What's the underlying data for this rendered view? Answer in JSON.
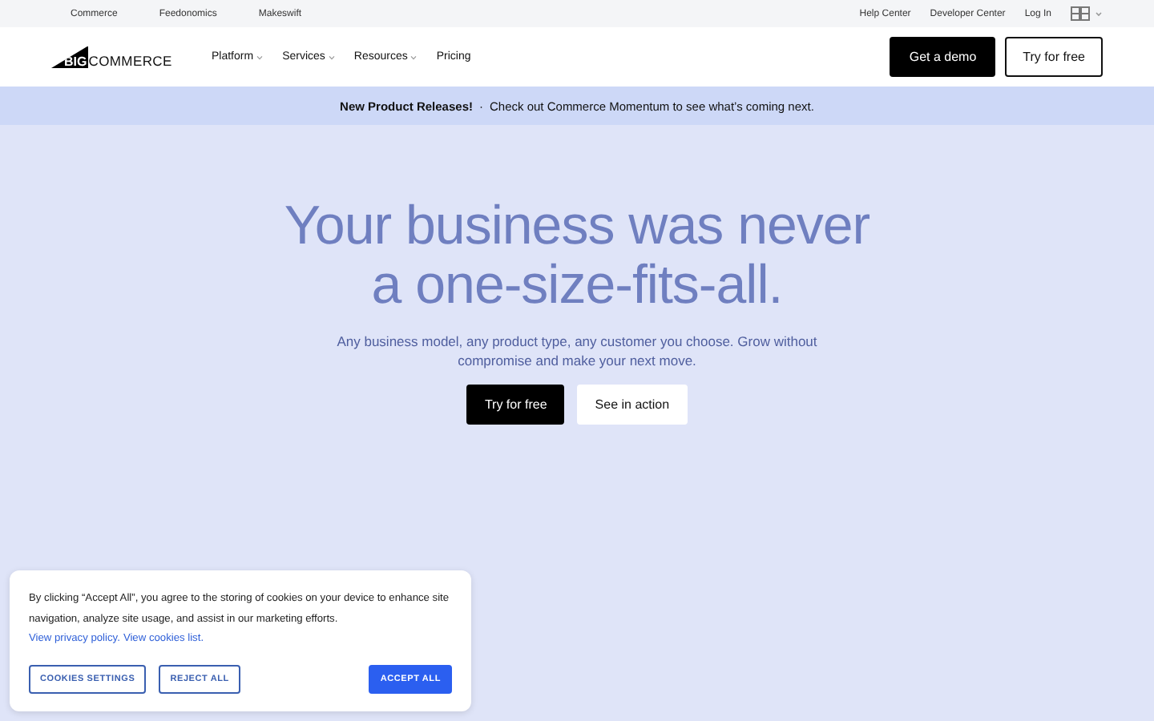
{
  "utility_bar": {
    "left_links": [
      "Commerce",
      "Feedonomics",
      "Makeswift"
    ],
    "right_links": [
      "Help Center",
      "Developer Center",
      "Log In"
    ]
  },
  "header": {
    "logo": {
      "mark": "BIG",
      "word": "COMMERCE"
    },
    "nav": [
      {
        "label": "Platform",
        "has_menu": true
      },
      {
        "label": "Services",
        "has_menu": true
      },
      {
        "label": "Resources",
        "has_menu": true
      },
      {
        "label": "Pricing",
        "has_menu": false
      }
    ],
    "buttons": [
      {
        "label": "Get a demo",
        "kind": "primary"
      },
      {
        "label": "Try for free",
        "kind": "outline"
      }
    ]
  },
  "announcement": {
    "title": "New Product Releases!",
    "separator": "·",
    "text": "Check out Commerce Momentum to see what’s coming next."
  },
  "hero": {
    "headline": [
      "Your business was never",
      "a one-size-fits-all."
    ],
    "subtext": "Any business model, any product type, any customer you choose. Grow without compromise and make your next move.",
    "buttons": [
      {
        "label": "Try for free",
        "kind": "primary"
      },
      {
        "label": "See in action",
        "kind": "light"
      }
    ]
  },
  "cookie_banner": {
    "text": "By clicking “Accept All”, you agree to the storing of cookies on your device to enhance site navigation, analyze site usage, and assist in our marketing efforts.",
    "links": [
      "View privacy policy.",
      "View cookies list."
    ],
    "buttons": [
      {
        "label": "COOKIES SETTINGS",
        "kind": "outline"
      },
      {
        "label": "REJECT ALL",
        "kind": "outline"
      },
      {
        "label": "ACCEPT ALL",
        "kind": "filled"
      }
    ]
  }
}
